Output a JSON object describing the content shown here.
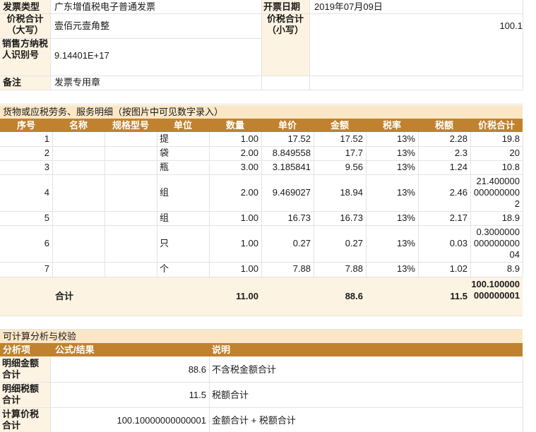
{
  "invoice": {
    "type_label": "发票类型",
    "type_value": "广东增值税电子普通发票",
    "date_label": "开票日期",
    "date_value": "2019年07月09日",
    "total_upper_label": "价税合计\n（大写）",
    "total_upper_value": "壹佰元壹角整",
    "total_lower_label": "价税合计\n（小写）",
    "total_lower_value": "100.1",
    "seller_tax_label": "销售方纳税人识别号",
    "seller_tax_value": "9.14401E+17",
    "note_label": "备注",
    "note_value": "发票专用章"
  },
  "details": {
    "section_title": "货物或应税劳务、服务明细（按图片中可见数字录入）",
    "headers": [
      "序号",
      "名称",
      "规格型号",
      "单位",
      "数量",
      "单价",
      "金额",
      "税率",
      "税额",
      "价税合计"
    ],
    "rows": [
      {
        "no": "1",
        "name": "",
        "spec": "",
        "unit": "提",
        "qty": "1.00",
        "price": "17.52",
        "amount": "17.52",
        "rate": "13%",
        "tax": "2.28",
        "total": "19.8"
      },
      {
        "no": "2",
        "name": "",
        "spec": "",
        "unit": "袋",
        "qty": "2.00",
        "price": "8.849558",
        "amount": "17.7",
        "rate": "13%",
        "tax": "2.3",
        "total": "20"
      },
      {
        "no": "3",
        "name": "",
        "spec": "",
        "unit": "瓶",
        "qty": "3.00",
        "price": "3.185841",
        "amount": "9.56",
        "rate": "13%",
        "tax": "1.24",
        "total": "10.8"
      },
      {
        "no": "4",
        "name": "",
        "spec": "",
        "unit": "组",
        "qty": "2.00",
        "price": "9.469027",
        "amount": "18.94",
        "rate": "13%",
        "tax": "2.46",
        "total": "21.4000000000000002"
      },
      {
        "no": "5",
        "name": "",
        "spec": "",
        "unit": "组",
        "qty": "1.00",
        "price": "16.73",
        "amount": "16.73",
        "rate": "13%",
        "tax": "2.17",
        "total": "18.9"
      },
      {
        "no": "6",
        "name": "",
        "spec": "",
        "unit": "只",
        "qty": "1.00",
        "price": "0.27",
        "amount": "0.27",
        "rate": "13%",
        "tax": "0.03",
        "total": "0.300000000000000004"
      },
      {
        "no": "7",
        "name": "",
        "spec": "",
        "unit": "个",
        "qty": "1.00",
        "price": "7.88",
        "amount": "7.88",
        "rate": "13%",
        "tax": "1.02",
        "total": "8.9"
      }
    ],
    "sum": {
      "label": "合计",
      "qty": "11.00",
      "amount": "88.6",
      "tax": "11.5",
      "total": "100.100000000000001"
    }
  },
  "analysis": {
    "section_title": "可计算分析与校验",
    "headers": [
      "分析项",
      "公式/结果",
      "说明"
    ],
    "rows": [
      {
        "item": "明细金额合计",
        "value": "88.6",
        "note": "不含税金额合计"
      },
      {
        "item": "明细税额合计",
        "value": "11.5",
        "note": "税额合计"
      },
      {
        "item": "计算价税合计",
        "value": "100.10000000000001",
        "note": "金额合计 + 税额合计"
      }
    ]
  },
  "colors": {
    "header_bar": "#c0822e",
    "section_band": "#fbe7c6",
    "label_band": "#fdf3e2"
  }
}
